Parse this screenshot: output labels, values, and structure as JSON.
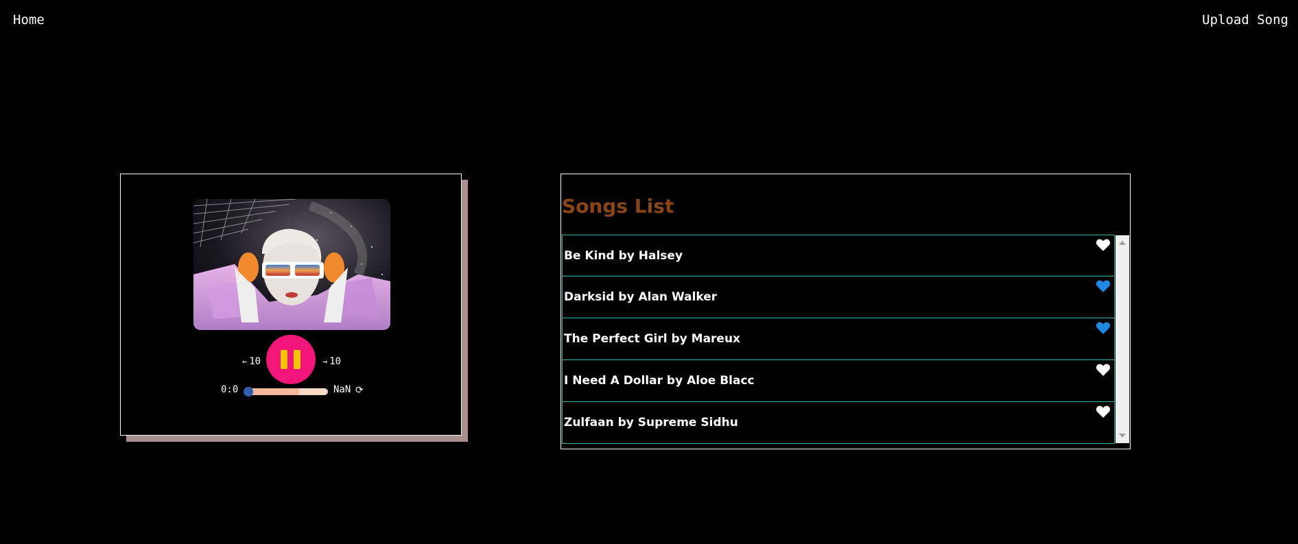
{
  "nav": {
    "home": "Home",
    "upload": "Upload Song"
  },
  "player": {
    "cover_alt": "album-art",
    "seek_back_label": "10",
    "seek_forward_label": "10",
    "current_time": "0:0",
    "total_time": "NaN",
    "is_playing": true,
    "progress_fraction": 0.0,
    "buffered_fraction": 0.65,
    "colors": {
      "play_button": "#f2157a",
      "pause_bars": "#f5c400",
      "track": "#f7d9c6",
      "thumb": "#2f5fb0"
    }
  },
  "songs": {
    "title": "Songs List",
    "title_color": "#8b4513",
    "items": [
      {
        "name": "Be Kind by Halsey",
        "liked": false
      },
      {
        "name": "Darksid by Alan Walker",
        "liked": true
      },
      {
        "name": "The Perfect Girl by Mareux",
        "liked": true
      },
      {
        "name": "I Need A Dollar by Aloe Blacc",
        "liked": false
      },
      {
        "name": "Zulfaan by Supreme Sidhu",
        "liked": false
      }
    ],
    "colors": {
      "liked": "#1e88e5",
      "unliked": "#ffffff",
      "row_border": "#2cb8b0"
    }
  }
}
